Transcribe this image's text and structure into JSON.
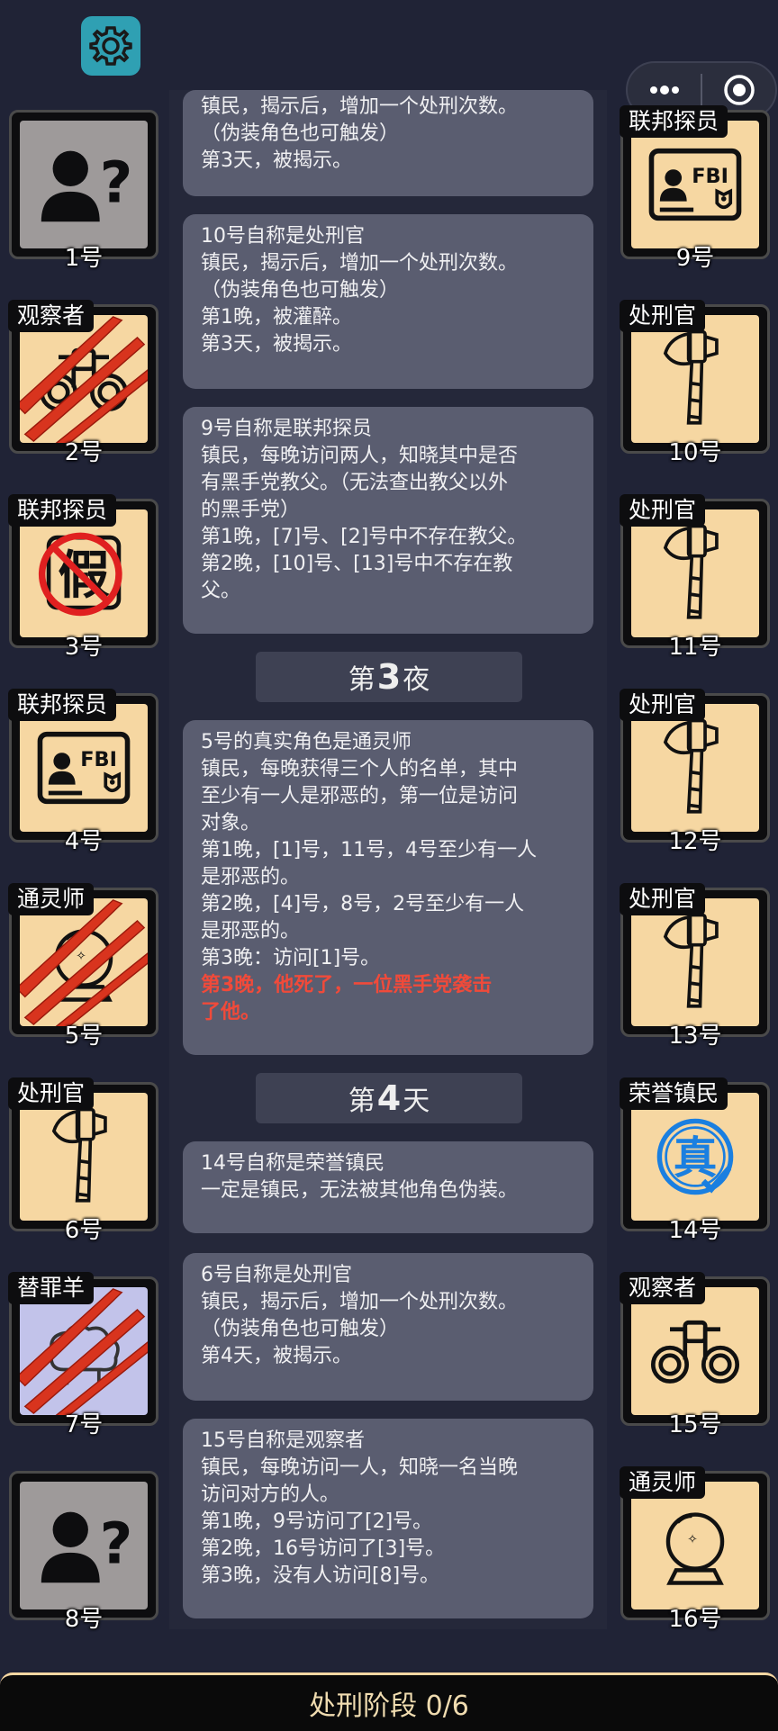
{
  "ui": {
    "settings_icon": "gear-icon",
    "menu_icon": "more-dots-icon",
    "close_icon": "record-icon"
  },
  "bottom_bar": {
    "label": "处刑阶段 0/6"
  },
  "left_players": [
    {
      "num": "1号",
      "role": "",
      "bg": "gray",
      "icon": "unknown-person-icon",
      "dead": false
    },
    {
      "num": "2号",
      "role": "观察者",
      "bg": "beige",
      "icon": "binoculars-icon",
      "dead": true
    },
    {
      "num": "3号",
      "role": "联邦探员",
      "bg": "beige",
      "icon": "fake-stamp-icon",
      "dead": false
    },
    {
      "num": "4号",
      "role": "联邦探员",
      "bg": "beige",
      "icon": "fbi-badge-icon",
      "dead": false
    },
    {
      "num": "5号",
      "role": "通灵师",
      "bg": "beige",
      "icon": "crystal-ball-icon",
      "dead": true
    },
    {
      "num": "6号",
      "role": "处刑官",
      "bg": "beige",
      "icon": "axe-icon",
      "dead": false
    },
    {
      "num": "7号",
      "role": "替罪羊",
      "bg": "lav",
      "icon": "sheep-icon",
      "dead": true
    },
    {
      "num": "8号",
      "role": "",
      "bg": "gray",
      "icon": "unknown-person-icon",
      "dead": false
    }
  ],
  "right_players": [
    {
      "num": "9号",
      "role": "联邦探员",
      "bg": "beige",
      "icon": "fbi-badge-icon",
      "dead": false
    },
    {
      "num": "10号",
      "role": "处刑官",
      "bg": "beige",
      "icon": "axe-icon",
      "dead": false
    },
    {
      "num": "11号",
      "role": "处刑官",
      "bg": "beige",
      "icon": "axe-icon",
      "dead": false
    },
    {
      "num": "12号",
      "role": "处刑官",
      "bg": "beige",
      "icon": "axe-icon",
      "dead": false
    },
    {
      "num": "13号",
      "role": "处刑官",
      "bg": "beige",
      "icon": "axe-icon",
      "dead": false
    },
    {
      "num": "14号",
      "role": "荣誉镇民",
      "bg": "beige",
      "icon": "true-stamp-icon",
      "dead": false
    },
    {
      "num": "15号",
      "role": "观察者",
      "bg": "beige",
      "icon": "binoculars-icon",
      "dead": false
    },
    {
      "num": "16号",
      "role": "通灵师",
      "bg": "beige",
      "icon": "crystal-ball-icon",
      "dead": false
    }
  ],
  "phases": [
    {
      "pre": "第",
      "num": "3",
      "post": "夜"
    },
    {
      "pre": "第",
      "num": "4",
      "post": "天"
    }
  ],
  "stamps": {
    "fake": "假",
    "true": "真",
    "fbi": "FBI"
  },
  "cards": [
    {
      "lines": [
        "镇民，揭示后，增加一个处刑次数。",
        "（伪装角色也可触发）",
        "第3天，被揭示。"
      ]
    },
    {
      "lines": [
        "10号自称是处刑官",
        "镇民，揭示后，增加一个处刑次数。",
        "（伪装角色也可触发）",
        "第1晚，被灌醉。",
        "第3天，被揭示。"
      ]
    },
    {
      "lines": [
        "9号自称是联邦探员",
        "镇民，每晚访问两人，知晓其中是否",
        "有黑手党教父。（无法查出教父以外",
        "的黑手党）",
        "第1晚，[7]号、[2]号中不存在教父。",
        "第2晚，[10]号、[13]号中不存在教",
        "父。"
      ]
    },
    {
      "lines": [
        "5号的真实角色是通灵师",
        "镇民，每晚获得三个人的名单，其中",
        "至少有一人是邪恶的，第一位是访问",
        "对象。",
        "第1晚，[1]号，11号，4号至少有一人",
        "是邪恶的。",
        "第2晚，[4]号，8号，2号至少有一人",
        "是邪恶的。",
        "第3晚：访问[1]号。"
      ],
      "red": [
        "第3晚，他死了，一位黑手党袭击",
        "了他。"
      ]
    },
    {
      "lines": [
        "14号自称是荣誉镇民",
        "一定是镇民，无法被其他角色伪装。"
      ]
    },
    {
      "lines": [
        "6号自称是处刑官",
        "镇民，揭示后，增加一个处刑次数。",
        "（伪装角色也可触发）",
        "第4天，被揭示。"
      ]
    },
    {
      "lines": [
        "15号自称是观察者",
        "镇民，每晚访问一人，知晓一名当晚",
        "访问对方的人。",
        "第1晚，9号访问了[2]号。",
        "第2晚，16号访问了[3]号。",
        "第3晚，没有人访问[8]号。"
      ]
    }
  ]
}
